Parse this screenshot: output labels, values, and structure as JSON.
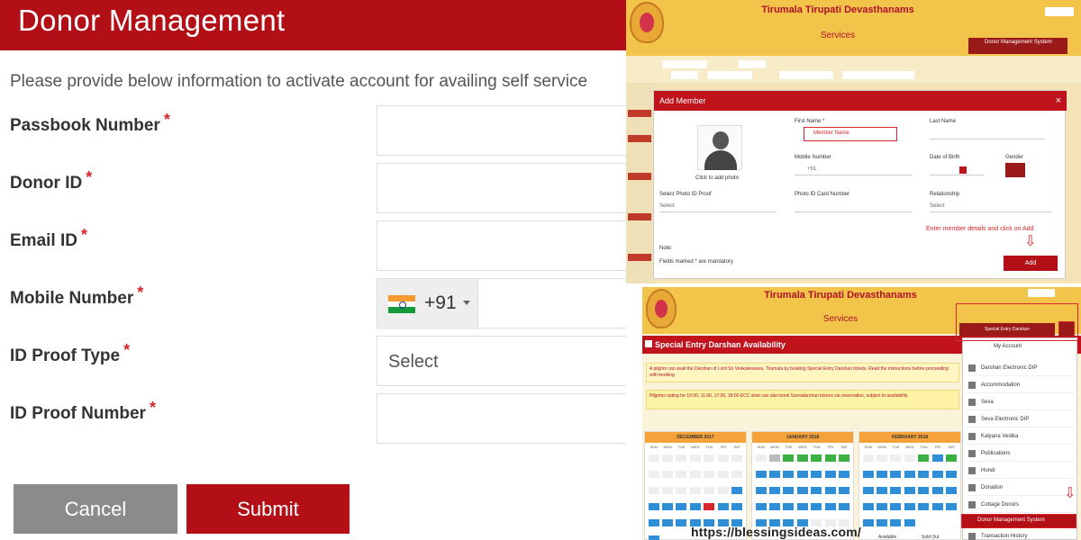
{
  "form": {
    "title": "Donor Management",
    "intro": "Please provide below information to activate account for availing self service",
    "fields": [
      {
        "label": "Passbook Number",
        "required": "*"
      },
      {
        "label": "Donor ID",
        "required": "*"
      },
      {
        "label": "Email ID",
        "required": "*"
      },
      {
        "label": "Mobile Number",
        "required": "*",
        "country_code": "+91"
      },
      {
        "label": "ID Proof Type",
        "required": "*",
        "value": "Select"
      },
      {
        "label": "ID Proof Number",
        "required": "*"
      }
    ],
    "cancel_label": "Cancel",
    "submit_label": "Submit"
  },
  "site": {
    "name": "Tirumala Tirupati Devasthanams",
    "sub": "Services"
  },
  "add_member": {
    "title": "Add Member",
    "close": "×",
    "photo_caption": "Click to add photo",
    "first_name": "First Name *",
    "first_name_value": "Member Name",
    "last_name": "Last Name",
    "mobile": "Mobile Number",
    "mobile_cc": "+91",
    "dob": "Date of Birth",
    "gender": "Gender",
    "photo_id": "Select Photo ID Proof",
    "photo_id_value": "Select",
    "photo_id_number": "Photo ID Card Number",
    "relationship": "Relationship",
    "relationship_value": "Select",
    "hint": "Enter member details and click on Add",
    "note": "Note:",
    "note_text": "Fields marked * are mandatory",
    "add_label": "Add",
    "menu_button": "Donor Management System"
  },
  "darshan": {
    "bar_title": "Special Entry Darshan Availability",
    "special_btn": "Special Entry Darshan",
    "notice": "A pilgrim can avail the Darshan of Lord Sri Venkateswara, Tirumala by booking Special Entry Darshan tickets. Read the instructions before proceeding with booking",
    "notice2": "Pilgrims opting for 10:00, 11:00, 17:00, 18:00 ECC slots can also book Sarvadarshan tokens via reservation, subject to availability",
    "calendars": [
      {
        "month": "DECEMBER 2017"
      },
      {
        "month": "JANUARY 2018"
      },
      {
        "month": "FEBRUARY 2018"
      }
    ],
    "dows": [
      "SUN",
      "MON",
      "TUE",
      "WED",
      "THU",
      "FRI",
      "SAT"
    ],
    "menu_top": "My Account",
    "menu_items": [
      "Darshan Electronic DIP",
      "Accommodation",
      "Seva",
      "Seva Electronic DIP",
      "Kalyana Vedika",
      "Publications",
      "Hundi",
      "Donation",
      "Cottage Donors"
    ],
    "menu_active": "Donor Management System",
    "menu_last": "Transaction History",
    "legend": [
      "Available",
      "Sold Out"
    ]
  },
  "watermark": {
    "url": "https://blessingsideas.com/"
  },
  "colors": {
    "brand_red": "#b30f16",
    "cancel_gray": "#8b8b8b",
    "ttd_gold": "#f2c44a"
  }
}
